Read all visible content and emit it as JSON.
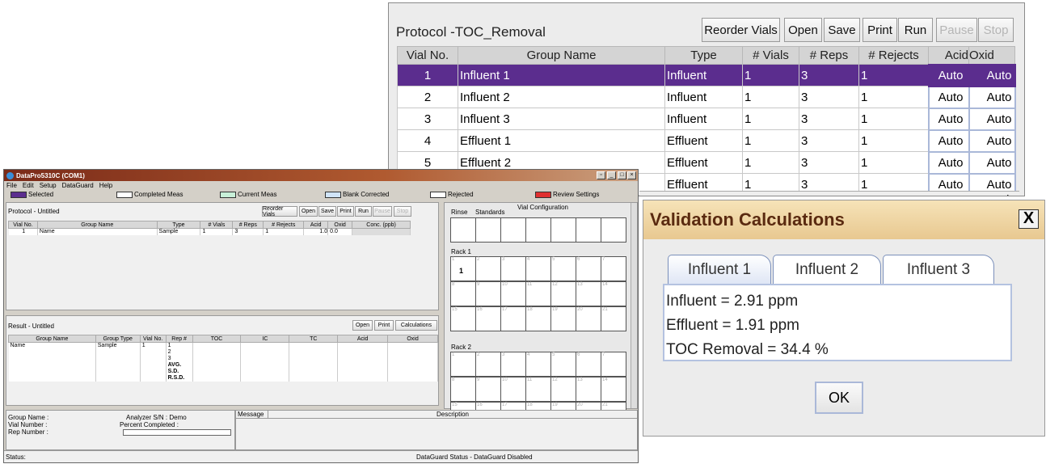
{
  "zoom": {
    "title": "Protocol -TOC_Removal",
    "buttons": [
      "Reorder Vials",
      "Open",
      "Save",
      "Print",
      "Run",
      "Pause",
      "Stop"
    ],
    "headers": [
      "Vial No.",
      "Group Name",
      "Type",
      "# Vials",
      "# Reps",
      "# Rejects",
      "Acid",
      "Oxid"
    ],
    "rows": [
      {
        "vial": "1",
        "name": "Influent 1",
        "type": "Influent",
        "vials": "1",
        "reps": "3",
        "rejects": "1",
        "acid": "Auto",
        "oxid": "Auto"
      },
      {
        "vial": "2",
        "name": "Influent 2",
        "type": "Influent",
        "vials": "1",
        "reps": "3",
        "rejects": "1",
        "acid": "Auto",
        "oxid": "Auto"
      },
      {
        "vial": "3",
        "name": "Influent 3",
        "type": "Influent",
        "vials": "1",
        "reps": "3",
        "rejects": "1",
        "acid": "Auto",
        "oxid": "Auto"
      },
      {
        "vial": "4",
        "name": "Effluent 1",
        "type": "Effluent",
        "vials": "1",
        "reps": "3",
        "rejects": "1",
        "acid": "Auto",
        "oxid": "Auto"
      },
      {
        "vial": "5",
        "name": "Effluent 2",
        "type": "Effluent",
        "vials": "1",
        "reps": "3",
        "rejects": "1",
        "acid": "Auto",
        "oxid": "Auto"
      },
      {
        "vial": "",
        "name": "",
        "type": "Effluent",
        "vials": "1",
        "reps": "3",
        "rejects": "1",
        "acid": "Auto",
        "oxid": "Auto"
      }
    ],
    "selected_color": "#5b2d8e"
  },
  "app": {
    "title": "DataPro5310C (COM1)",
    "menu": [
      "File",
      "Edit",
      "Setup",
      "DataGuard",
      "Help"
    ],
    "legend": [
      {
        "label": "Selected",
        "color": "#5b2d8e"
      },
      {
        "label": "Completed Meas",
        "color": "#ffffff"
      },
      {
        "label": "Current Meas",
        "color": "#c8f0d8"
      },
      {
        "label": "Blank Corrected",
        "color": "#d0e4f8"
      },
      {
        "label": "Rejected",
        "color": "#ffffff"
      },
      {
        "label": "Review Settings",
        "color": "#e03030"
      }
    ],
    "protocol": {
      "title": "Protocol - Untitled",
      "buttons": [
        "Reorder Vials",
        "Open",
        "Save",
        "Print",
        "Run",
        "Pause",
        "Stop"
      ],
      "headers": [
        "Vial No.",
        "Group Name",
        "Type",
        "# Vials",
        "# Reps",
        "# Rejects",
        "Acid",
        "Oxid",
        "Conc. (ppb)"
      ],
      "row": {
        "vial": "1",
        "name": "Name",
        "type": "Sample",
        "vials": "1",
        "reps": "3",
        "rejects": "1",
        "acid": "1.0",
        "oxid": "0.0",
        "conc": ""
      }
    },
    "result": {
      "title": "Result - Untitled",
      "buttons": [
        "Open",
        "Print",
        "Calculations"
      ],
      "headers": [
        "Group Name",
        "Group Type",
        "Vial No.",
        "Rep #",
        "TOC",
        "IC",
        "TC",
        "Acid",
        "Oxid"
      ],
      "rows": [
        {
          "name": "Name",
          "type": "Sample",
          "vial": "1",
          "rep": "1"
        },
        {
          "name": "",
          "type": "",
          "vial": "",
          "rep": "2"
        },
        {
          "name": "",
          "type": "",
          "vial": "",
          "rep": "3"
        },
        {
          "name": "",
          "type": "",
          "vial": "",
          "rep": "AVG."
        },
        {
          "name": "",
          "type": "",
          "vial": "",
          "rep": "S.D."
        },
        {
          "name": "",
          "type": "",
          "vial": "",
          "rep": "R.S.D."
        }
      ]
    },
    "vialconf": {
      "title": "Vial Configuration",
      "rinse": "Rinse",
      "standards": "Standards",
      "rack1": "Rack 1",
      "rack2": "Rack 2",
      "rack1_row1": [
        "1",
        "2",
        "3",
        "4",
        "5",
        "6",
        "7"
      ],
      "rack1_row2": [
        "8",
        "9",
        "10",
        "11",
        "12",
        "13",
        "14"
      ],
      "rack1_row3": [
        "15",
        "16",
        "17",
        "18",
        "19",
        "20",
        "21"
      ],
      "rack2_row1": [
        "1",
        "2",
        "3",
        "4",
        "5",
        "6",
        "7"
      ],
      "rack2_row2": [
        "8",
        "9",
        "10",
        "11",
        "12",
        "13",
        "14"
      ],
      "rack2_row3": [
        "15",
        "16",
        "17",
        "18",
        "19",
        "20",
        "21"
      ],
      "marker": "1"
    },
    "info": {
      "group_name": "Group Name :",
      "vial_number": "Vial Number :",
      "rep_number": "Rep Number :",
      "analyzer": "Analyzer S/N : Demo",
      "percent": "Percent Completed :",
      "message": "Message",
      "description": "Description"
    },
    "status": "Status:",
    "dataguard": "DataGuard Status - DataGuard Disabled"
  },
  "dialog": {
    "title": "Validation Calculations",
    "close": "X",
    "tabs": [
      "Influent 1",
      "Influent 2",
      "Influent 3"
    ],
    "lines": [
      "Influent =  2.91 ppm",
      "Effluent =  1.91 ppm",
      "TOC Removal  = 34.4 %"
    ],
    "ok": "OK"
  }
}
